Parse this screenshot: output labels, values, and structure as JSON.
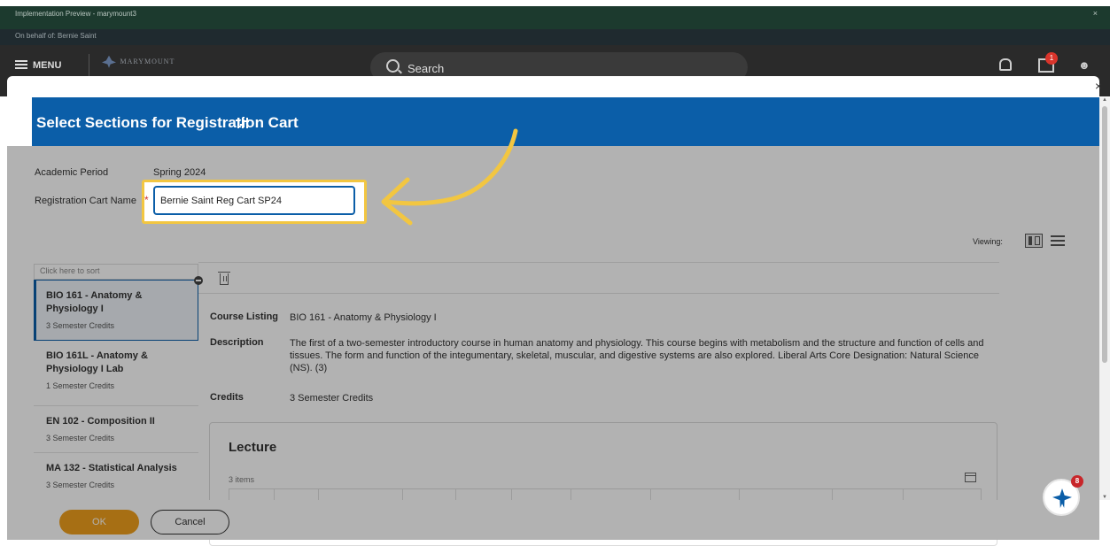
{
  "app": {
    "impl_title": "Implementation Preview - marymount3",
    "impl_close": "×",
    "on_behalf": "On behalf of: Bernie Saint",
    "menu_label": "MENU",
    "logo_text": "MARYMOUNT",
    "search_label": "Search",
    "inbox_badge": "1"
  },
  "modal": {
    "close_glyph": "×",
    "title": "Select Sections for Registration Cart"
  },
  "form": {
    "academic_period_label": "Academic Period",
    "academic_period_value": "Spring 2024",
    "cart_name_label": "Registration Cart Name",
    "required_mark": "*",
    "cart_name_value": "Bernie Saint Reg Cart SP24"
  },
  "viewing": {
    "label": "Viewing:"
  },
  "sort": {
    "placeholder": "Click here to sort"
  },
  "courses": [
    {
      "title": "BIO 161 - Anatomy & Physiology I",
      "credits": "3 Semester Credits"
    },
    {
      "title": "BIO 161L - Anatomy & Physiology I Lab",
      "credits": "1 Semester Credits"
    },
    {
      "title": "EN 102 - Composition II",
      "credits": "3 Semester Credits"
    },
    {
      "title": "MA 132 - Statistical Analysis",
      "credits": "3 Semester Credits"
    }
  ],
  "detail": {
    "course_listing_label": "Course Listing",
    "course_listing_value": "BIO 161 - Anatomy & Physiology I",
    "description_label": "Description",
    "description_value": "The first of a two-semester introductory course in human anatomy and physiology. This course begins with metabolism and the structure and function of cells and tissues. The form and function of the integumentary, skeletal, muscular, and digestive systems are also explored. Liberal Arts Core Designation: Natural Science (NS). (3)",
    "credits_label": "Credits",
    "credits_value": "3 Semester Credits"
  },
  "lecture": {
    "title": "Lecture",
    "count": "3 items"
  },
  "footer": {
    "ok_label": "OK",
    "cancel_label": "Cancel"
  },
  "assistant": {
    "badge": "8"
  },
  "colors": {
    "accent": "#0b5ea8",
    "highlight": "#f2c641",
    "ok": "#f0a01e"
  }
}
